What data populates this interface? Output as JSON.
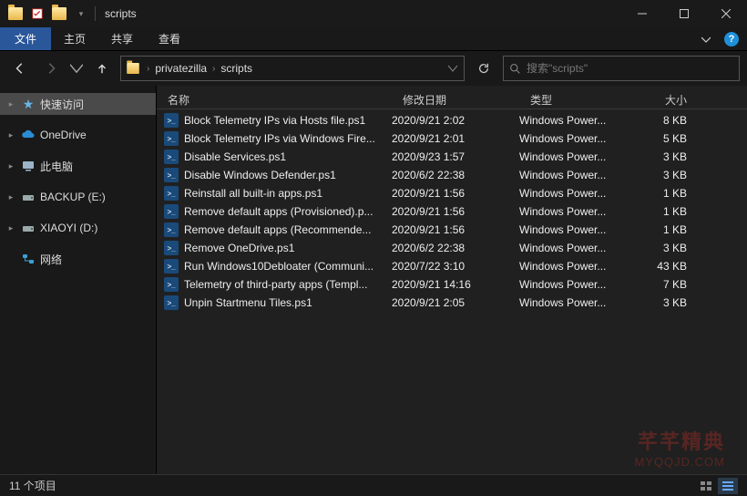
{
  "window": {
    "title": "scripts"
  },
  "ribbon": {
    "file": "文件",
    "tabs": [
      "主页",
      "共享",
      "查看"
    ]
  },
  "breadcrumb": {
    "items": [
      "privatezilla",
      "scripts"
    ]
  },
  "search": {
    "placeholder": "搜索\"scripts\""
  },
  "sidebar": {
    "quick": "快速访问",
    "onedrive": "OneDrive",
    "pc": "此电脑",
    "backup": "BACKUP (E:)",
    "xiaoyi": "XIAOYI (D:)",
    "network": "网络"
  },
  "columns": {
    "name": "名称",
    "date": "修改日期",
    "type": "类型",
    "size": "大小"
  },
  "files": [
    {
      "name": "Block Telemetry IPs via Hosts file.ps1",
      "date": "2020/9/21 2:02",
      "type": "Windows Power...",
      "size": "8 KB"
    },
    {
      "name": "Block Telemetry IPs via Windows Fire...",
      "date": "2020/9/21 2:01",
      "type": "Windows Power...",
      "size": "5 KB"
    },
    {
      "name": "Disable Services.ps1",
      "date": "2020/9/23 1:57",
      "type": "Windows Power...",
      "size": "3 KB"
    },
    {
      "name": "Disable Windows Defender.ps1",
      "date": "2020/6/2 22:38",
      "type": "Windows Power...",
      "size": "3 KB"
    },
    {
      "name": "Reinstall all built-in apps.ps1",
      "date": "2020/9/21 1:56",
      "type": "Windows Power...",
      "size": "1 KB"
    },
    {
      "name": "Remove default apps (Provisioned).p...",
      "date": "2020/9/21 1:56",
      "type": "Windows Power...",
      "size": "1 KB"
    },
    {
      "name": "Remove default apps (Recommende...",
      "date": "2020/9/21 1:56",
      "type": "Windows Power...",
      "size": "1 KB"
    },
    {
      "name": "Remove OneDrive.ps1",
      "date": "2020/6/2 22:38",
      "type": "Windows Power...",
      "size": "3 KB"
    },
    {
      "name": "Run Windows10Debloater (Communi...",
      "date": "2020/7/22 3:10",
      "type": "Windows Power...",
      "size": "43 KB"
    },
    {
      "name": "Telemetry of third-party apps (Templ...",
      "date": "2020/9/21 14:16",
      "type": "Windows Power...",
      "size": "7 KB"
    },
    {
      "name": "Unpin Startmenu Tiles.ps1",
      "date": "2020/9/21 2:05",
      "type": "Windows Power...",
      "size": "3 KB"
    }
  ],
  "status": {
    "count": "11 个项目"
  },
  "watermark": {
    "line1": "芊芊精典",
    "line2": "MYQQJD.COM"
  }
}
